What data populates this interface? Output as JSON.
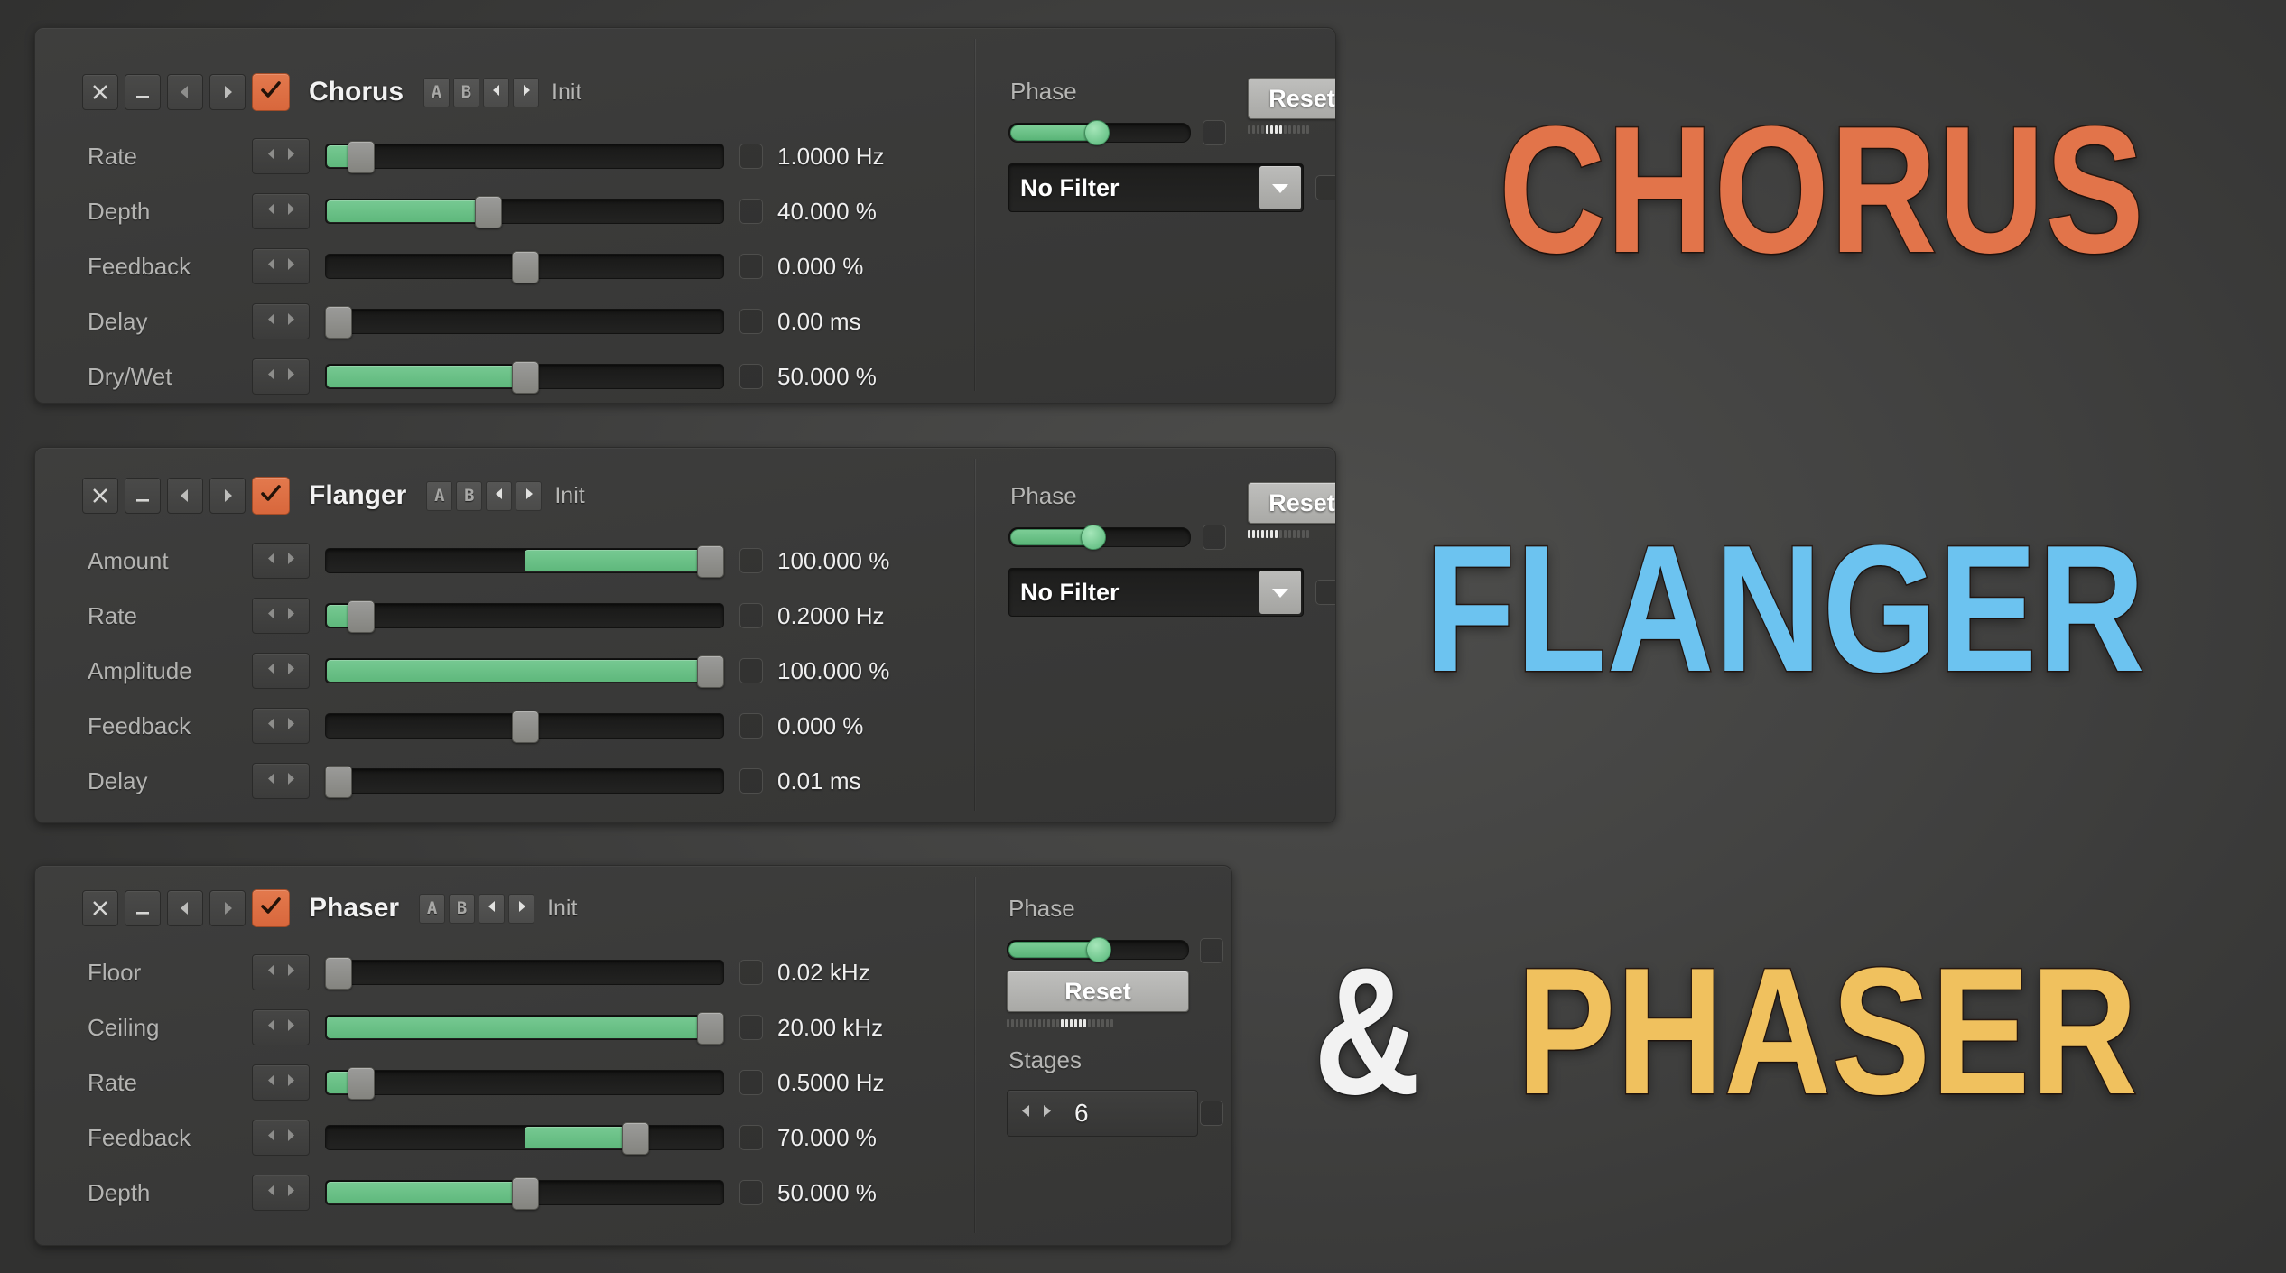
{
  "theme": {
    "accent_orange": "#dd6f42",
    "slider_green": "#6ec58c",
    "panel_bg": "#3b3b3a",
    "text_primary": "#efefef",
    "text_label": "#b4b4b2"
  },
  "headlines": [
    {
      "text": "CHORUS",
      "color": "#e2744a"
    },
    {
      "text": "FLANGER",
      "color": "#6cc3f0"
    },
    {
      "text": "&",
      "color": "#f2f2f2"
    },
    {
      "text": "PHASER",
      "color": "#f0c15e"
    }
  ],
  "titlebar_icons": {
    "close": "close-icon",
    "minimize": "minimize-icon",
    "prev": "left-arrow-icon",
    "next": "right-arrow-icon",
    "enable": "checkmark-icon"
  },
  "panels": [
    {
      "name": "Chorus",
      "enabled": true,
      "bank_a": "A",
      "bank_b": "B",
      "preset": "Init",
      "params": [
        {
          "label": "Rate",
          "value": "1.0000 Hz",
          "fill_start": 0,
          "fill_end": 7,
          "handle": 7
        },
        {
          "label": "Depth",
          "value": "40.000 %",
          "fill_start": 0,
          "fill_end": 40,
          "handle": 40
        },
        {
          "label": "Feedback",
          "value": "0.000 %",
          "fill_start": 50,
          "fill_end": 50,
          "handle": 50
        },
        {
          "label": "Delay",
          "value": "0.00 ms",
          "fill_start": 0,
          "fill_end": 0,
          "handle": 0
        },
        {
          "label": "Dry/Wet",
          "value": "50.000 %",
          "fill_start": 0,
          "fill_end": 50,
          "handle": 50
        }
      ],
      "phase": {
        "label": "Phase",
        "position": 48
      },
      "reset_label": "Reset",
      "filter": {
        "value": "No Filter"
      }
    },
    {
      "name": "Flanger",
      "enabled": true,
      "bank_a": "A",
      "bank_b": "B",
      "preset": "Init",
      "params": [
        {
          "label": "Amount",
          "value": "100.000 %",
          "fill_start": 50,
          "fill_end": 100,
          "handle": 100
        },
        {
          "label": "Rate",
          "value": "0.2000 Hz",
          "fill_start": 0,
          "fill_end": 7,
          "handle": 7
        },
        {
          "label": "Amplitude",
          "value": "100.000 %",
          "fill_start": 0,
          "fill_end": 100,
          "handle": 100
        },
        {
          "label": "Feedback",
          "value": "0.000 %",
          "fill_start": 50,
          "fill_end": 50,
          "handle": 50
        },
        {
          "label": "Delay",
          "value": "0.01 ms",
          "fill_start": 0,
          "fill_end": 0,
          "handle": 0
        }
      ],
      "phase": {
        "label": "Phase",
        "position": 46
      },
      "reset_label": "Reset",
      "filter": {
        "value": "No Filter"
      }
    },
    {
      "name": "Phaser",
      "enabled": true,
      "bank_a": "A",
      "bank_b": "B",
      "preset": "Init",
      "params": [
        {
          "label": "Floor",
          "value": "0.02 kHz",
          "fill_start": 0,
          "fill_end": 0,
          "handle": 0
        },
        {
          "label": "Ceiling",
          "value": "20.00 kHz",
          "fill_start": 0,
          "fill_end": 100,
          "handle": 100
        },
        {
          "label": "Rate",
          "value": "0.5000 Hz",
          "fill_start": 0,
          "fill_end": 7,
          "handle": 7
        },
        {
          "label": "Feedback",
          "value": "70.000 %",
          "fill_start": 50,
          "fill_end": 79,
          "handle": 79
        },
        {
          "label": "Depth",
          "value": "50.000 %",
          "fill_start": 0,
          "fill_end": 50,
          "handle": 50
        }
      ],
      "phase": {
        "label": "Phase",
        "position": 50
      },
      "reset_label": "Reset",
      "stages": {
        "label": "Stages",
        "value": "6"
      }
    }
  ]
}
